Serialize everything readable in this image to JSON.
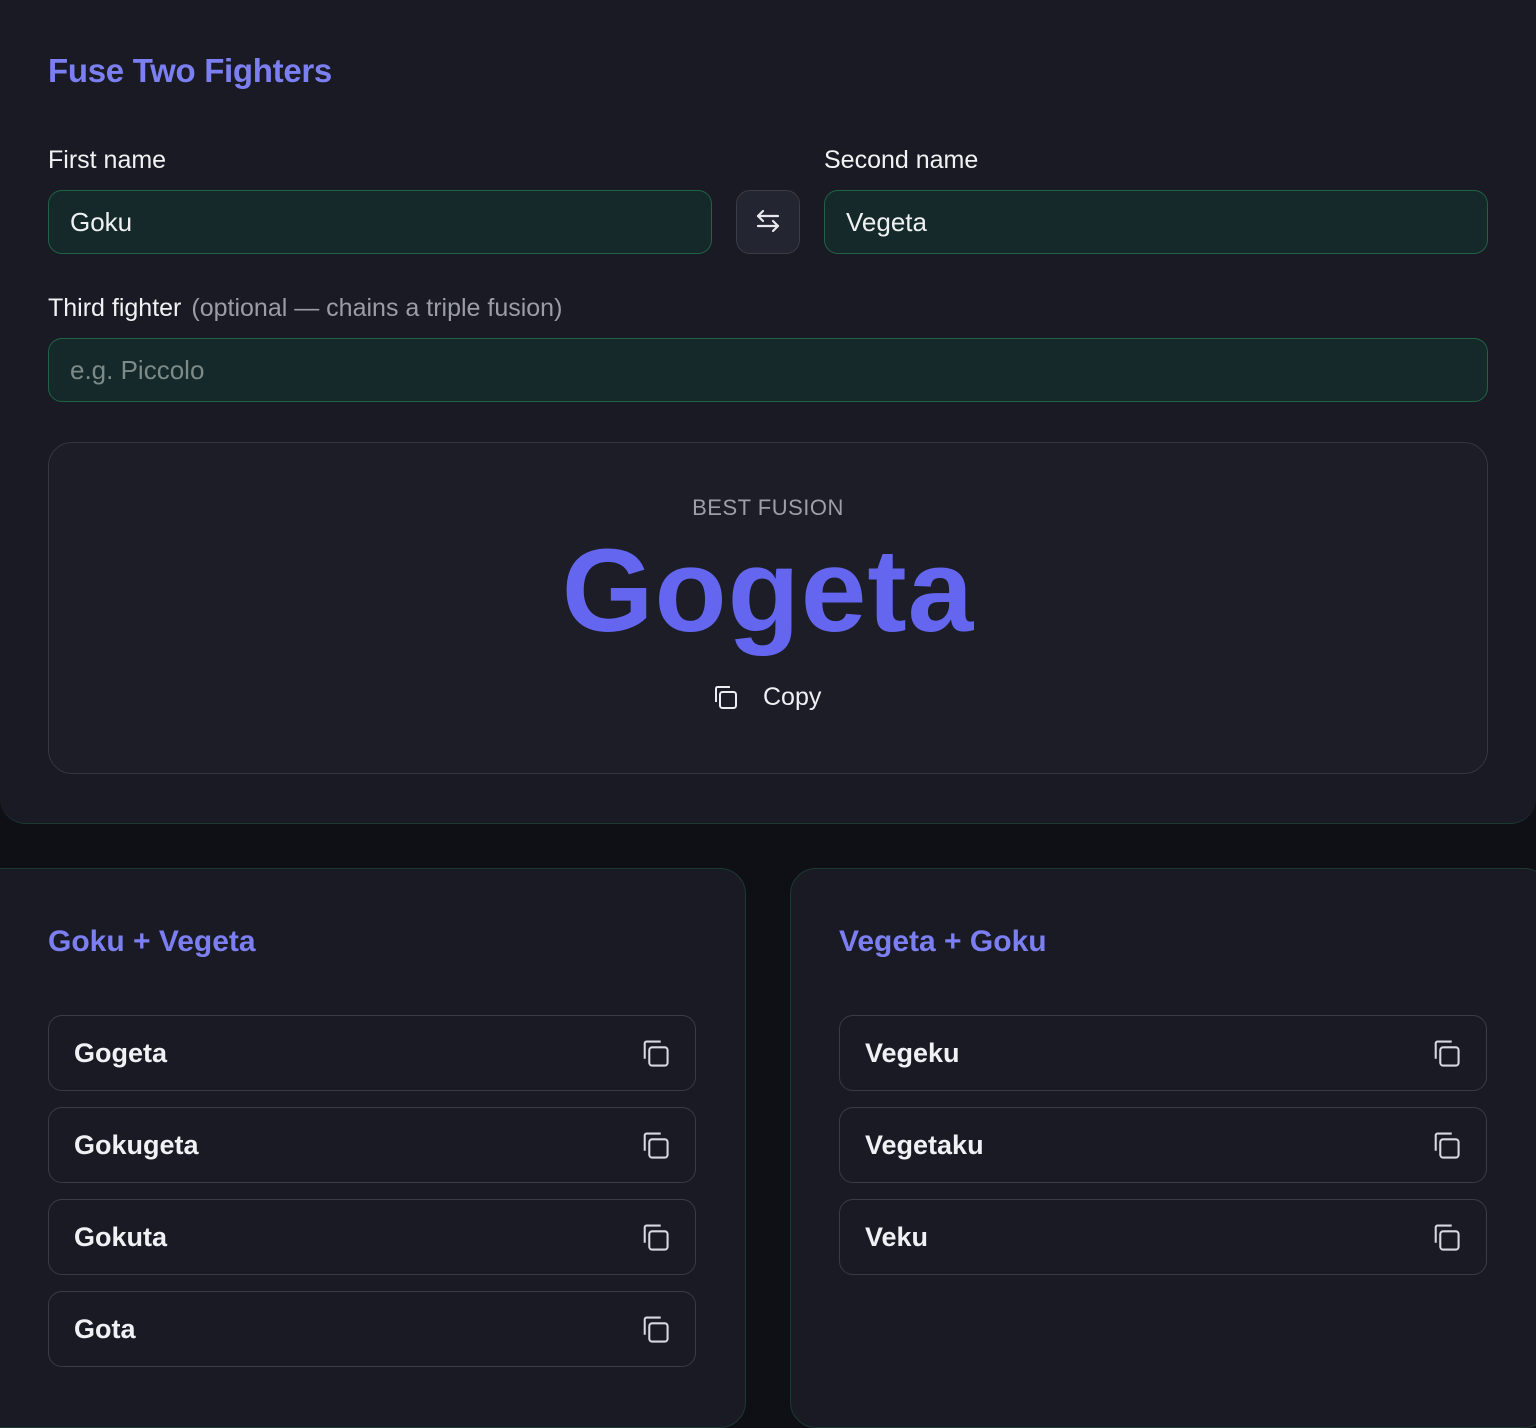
{
  "main": {
    "title": "Fuse Two Fighters",
    "first_label": "First name",
    "first_value": "Goku",
    "second_label": "Second name",
    "second_value": "Vegeta",
    "third_label": "Third fighter",
    "third_hint": "(optional — chains a triple fusion)",
    "third_placeholder": "e.g. Piccolo",
    "swap_icon": "swap-arrows-icon"
  },
  "result": {
    "label": "BEST FUSION",
    "name": "Gogeta",
    "copy_label": "Copy",
    "copy_icon": "copy-icon"
  },
  "lists": [
    {
      "title": "Goku + Vegeta",
      "items": [
        "Gogeta",
        "Gokugeta",
        "Gokuta",
        "Gota"
      ]
    },
    {
      "title": "Vegeta + Goku",
      "items": [
        "Vegeku",
        "Vegetaku",
        "Veku"
      ]
    }
  ],
  "colors": {
    "accent": "#6466f0",
    "title_accent": "#7c7ff2",
    "input_bg": "#16292a",
    "input_border": "#1f6346",
    "card_bg": "#191a23"
  }
}
